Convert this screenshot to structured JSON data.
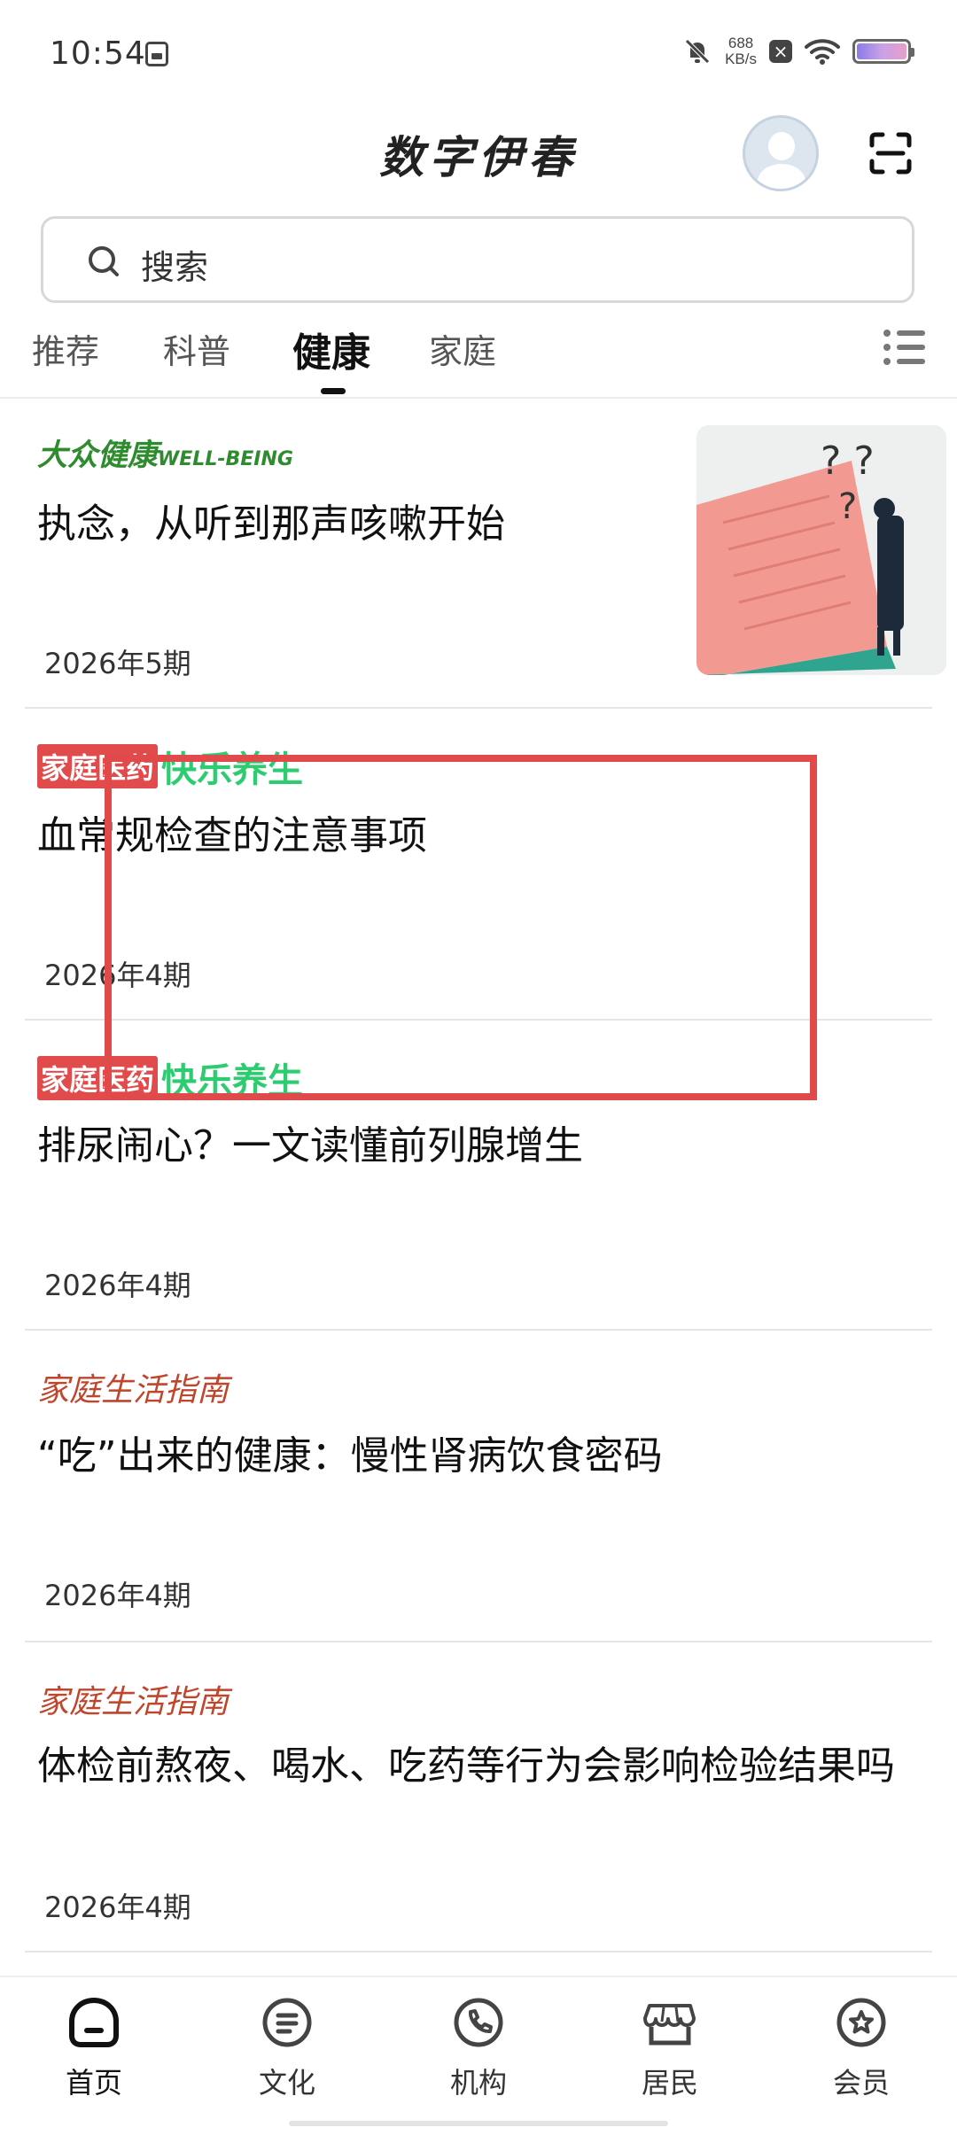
{
  "status_bar": {
    "time": "10:54",
    "net_speed_value": "688",
    "net_speed_unit": "KB/s"
  },
  "header": {
    "title": "数字伊春"
  },
  "search": {
    "placeholder": "搜索"
  },
  "tabs": [
    {
      "label": "推荐",
      "active": false
    },
    {
      "label": "科普",
      "active": false
    },
    {
      "label": "健康",
      "active": true
    },
    {
      "label": "家庭",
      "active": false
    }
  ],
  "feed": [
    {
      "source": "大众健康",
      "source_sub": "WELL-BEING",
      "title": "执念，从听到那声咳嗽开始",
      "issue": "2026年5期",
      "has_image": true
    },
    {
      "source_box": "家庭医药",
      "source_green": "快乐养生",
      "title": "血常规检查的注意事项",
      "issue": "2026年4期"
    },
    {
      "source_box": "家庭医药",
      "source_green": "快乐养生",
      "title": "排尿闹心？一文读懂前列腺增生",
      "issue": "2026年4期"
    },
    {
      "source": "家庭生活指南",
      "title": "“吃”出来的健康：慢性肾病饮食密码",
      "issue": "2026年4期"
    },
    {
      "source": "家庭生活指南",
      "title": "体检前熬夜、喝水、吃药等行为会影响检验结果吗",
      "issue": "2026年4期"
    }
  ],
  "bottom_nav": [
    {
      "label": "首页",
      "icon": "home-icon",
      "active": true
    },
    {
      "label": "文化",
      "icon": "document-icon"
    },
    {
      "label": "机构",
      "icon": "phone-icon"
    },
    {
      "label": "居民",
      "icon": "store-icon"
    },
    {
      "label": "会员",
      "icon": "star-badge-icon"
    }
  ]
}
